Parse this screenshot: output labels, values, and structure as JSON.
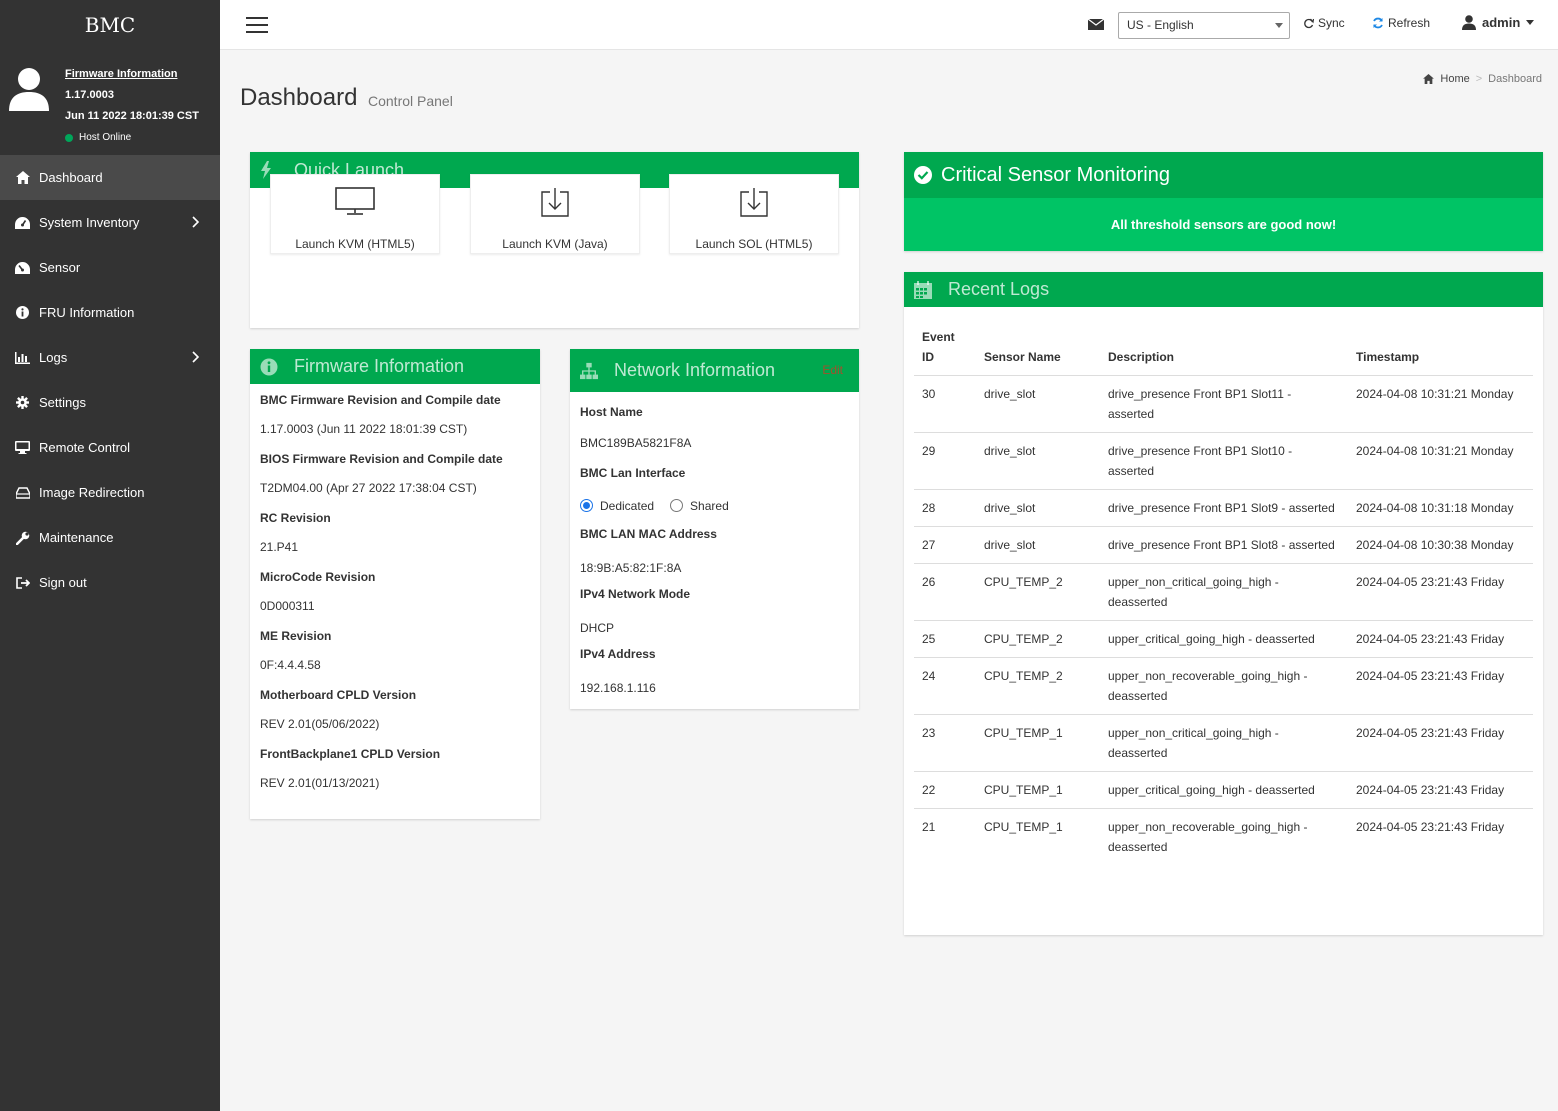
{
  "sidebar": {
    "brand": "BMC",
    "firmware_link": "Firmware Information",
    "firmware_version": "1.17.0003",
    "firmware_date": "Jun 11 2022 18:01:39 CST",
    "host_status": "Host Online",
    "items": [
      {
        "label": "Dashboard",
        "icon": "home-icon",
        "active": true
      },
      {
        "label": "System Inventory",
        "icon": "dashboard-icon",
        "submenu": true
      },
      {
        "label": "Sensor",
        "icon": "tachometer-icon"
      },
      {
        "label": "FRU Information",
        "icon": "info-circle-icon"
      },
      {
        "label": "Logs",
        "icon": "bar-chart-icon",
        "submenu": true
      },
      {
        "label": "Settings",
        "icon": "gear-icon"
      },
      {
        "label": "Remote Control",
        "icon": "desktop-icon"
      },
      {
        "label": "Image Redirection",
        "icon": "drive-icon"
      },
      {
        "label": "Maintenance",
        "icon": "wrench-icon"
      },
      {
        "label": "Sign out",
        "icon": "sign-out-icon"
      }
    ]
  },
  "topbar": {
    "language": "US - English",
    "sync": "Sync",
    "refresh": "Refresh",
    "user": "admin"
  },
  "page": {
    "title": "Dashboard",
    "subtitle": "Control Panel",
    "breadcrumb_home": "Home",
    "breadcrumb_current": "Dashboard"
  },
  "quick_launch": {
    "title": "Quick Launch",
    "buttons": [
      "Launch KVM (HTML5)",
      "Launch KVM (Java)",
      "Launch SOL (HTML5)"
    ]
  },
  "firmware": {
    "title": "Firmware Information",
    "rows": [
      {
        "k": "BMC Firmware Revision and Compile date",
        "v": "1.17.0003 (Jun 11 2022 18:01:39 CST)"
      },
      {
        "k": "BIOS Firmware Revision and Compile date",
        "v": "T2DM04.00 (Apr 27 2022 17:38:04 CST)"
      },
      {
        "k": "RC Revision",
        "v": "21.P41"
      },
      {
        "k": "MicroCode Revision",
        "v": "0D000311"
      },
      {
        "k": "ME Revision",
        "v": "0F:4.4.4.58"
      },
      {
        "k": "Motherboard CPLD Version",
        "v": "REV 2.01(05/06/2022)"
      },
      {
        "k": "FrontBackplane1 CPLD Version",
        "v": "REV 2.01(01/13/2021)"
      }
    ]
  },
  "network": {
    "title": "Network Information",
    "edit": "Edit",
    "host_name_label": "Host Name",
    "host_name": "BMC189BA5821F8A",
    "lan_label": "BMC Lan Interface",
    "dedicated": "Dedicated",
    "shared": "Shared",
    "mac_label": "BMC LAN MAC Address",
    "mac": "18:9B:A5:82:1F:8A",
    "mode_label": "IPv4 Network Mode",
    "mode": "DHCP",
    "ipv4_label": "IPv4 Address",
    "ipv4": "192.168.1.116"
  },
  "critical": {
    "title": "Critical Sensor Monitoring",
    "message": "All threshold sensors are good now!"
  },
  "logs": {
    "title": "Recent Logs",
    "headers": [
      "Event ID",
      "Sensor Name",
      "Description",
      "Timestamp"
    ],
    "rows": [
      [
        "30",
        "drive_slot",
        "drive_presence Front BP1 Slot11 - asserted",
        "2024-04-08 10:31:21 Monday"
      ],
      [
        "29",
        "drive_slot",
        "drive_presence Front BP1 Slot10 - asserted",
        "2024-04-08 10:31:21 Monday"
      ],
      [
        "28",
        "drive_slot",
        "drive_presence Front BP1 Slot9 - asserted",
        "2024-04-08 10:31:18 Monday"
      ],
      [
        "27",
        "drive_slot",
        "drive_presence Front BP1 Slot8 - asserted",
        "2024-04-08 10:30:38 Monday"
      ],
      [
        "26",
        "CPU_TEMP_2",
        "upper_non_critical_going_high - deasserted",
        "2024-04-05 23:21:43 Friday"
      ],
      [
        "25",
        "CPU_TEMP_2",
        "upper_critical_going_high - deasserted",
        "2024-04-05 23:21:43 Friday"
      ],
      [
        "24",
        "CPU_TEMP_2",
        "upper_non_recoverable_going_high - deasserted",
        "2024-04-05 23:21:43 Friday"
      ],
      [
        "23",
        "CPU_TEMP_1",
        "upper_non_critical_going_high - deasserted",
        "2024-04-05 23:21:43 Friday"
      ],
      [
        "22",
        "CPU_TEMP_1",
        "upper_critical_going_high - deasserted",
        "2024-04-05 23:21:43 Friday"
      ],
      [
        "21",
        "CPU_TEMP_1",
        "upper_non_recoverable_going_high - deasserted",
        "2024-04-05 23:21:43 Friday"
      ]
    ]
  },
  "colors": {
    "sidebar_bg": "#333333",
    "accent_green": "#00a84f",
    "alert_green": "#00c465"
  }
}
